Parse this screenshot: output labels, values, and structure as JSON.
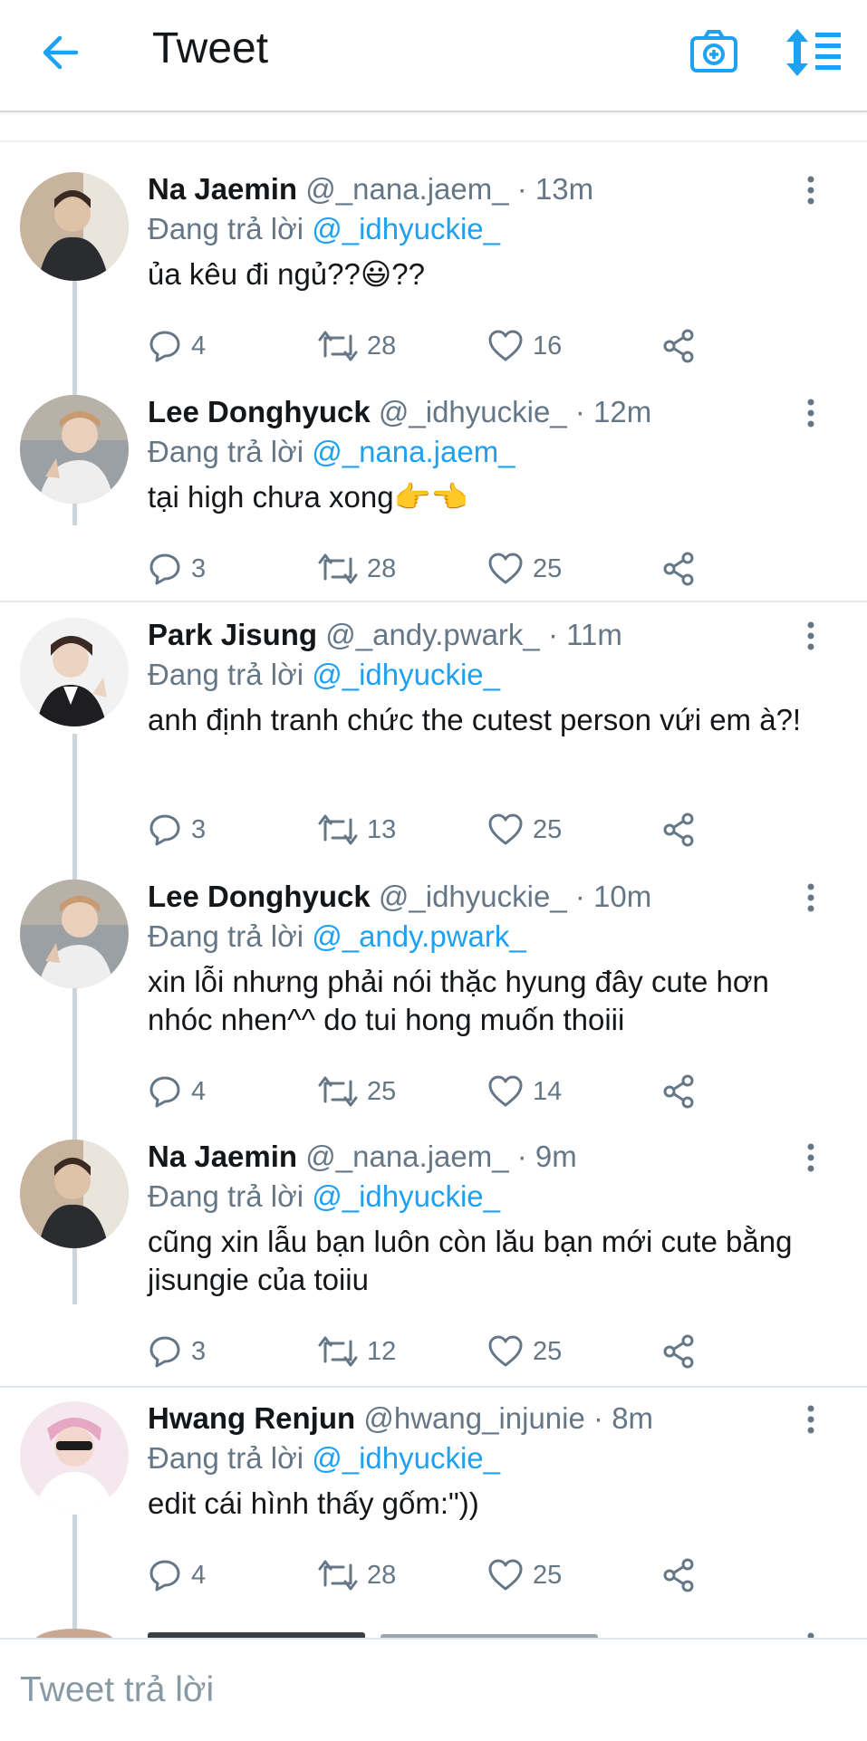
{
  "header": {
    "title": "Tweet",
    "back_icon": "arrow-left-icon",
    "camera_icon": "camera-plus-icon",
    "sort_icon": "sort-list-icon"
  },
  "colors": {
    "accent": "#1da1f2",
    "text": "#14171a",
    "muted": "#657786",
    "thread": "#ced5da"
  },
  "reply_prefix": "Đang trả lời",
  "tweets": [
    {
      "name": "Na Jaemin",
      "handle": "@_nana.jaem_",
      "time": "· 13m",
      "reply_to": "@_idhyuckie_",
      "text": "ủa kêu đi ngủ??😃??",
      "replies": "4",
      "retweets": "28",
      "likes": "16"
    },
    {
      "name": "Lee Donghyuck",
      "handle": "@_idhyuckie_",
      "time": "· 12m",
      "reply_to": "@_nana.jaem_",
      "text": "tại high chưa xong👉👈",
      "replies": "3",
      "retweets": "28",
      "likes": "25"
    },
    {
      "name": "Park Jisung",
      "handle": "@_andy.pwark_",
      "time": "· 11m",
      "reply_to": "@_idhyuckie_",
      "text": "anh định tranh chức the cutest person vứi em à?!",
      "replies": "3",
      "retweets": "13",
      "likes": "25"
    },
    {
      "name": "Lee Donghyuck",
      "handle": "@_idhyuckie_",
      "time": "· 10m",
      "reply_to": "@_andy.pwark_",
      "text": "xin lỗi nhưng phải nói thặc hyung đây cute hơn nhóc nhen^^ do tui hong muốn thoiii",
      "replies": "4",
      "retweets": "25",
      "likes": "14"
    },
    {
      "name": "Na Jaemin",
      "handle": "@_nana.jaem_",
      "time": "· 9m",
      "reply_to": "@_idhyuckie_",
      "text": "cũng xin lẫu bạn luôn còn lău bạn mới cute bằng jisungie của toiiu",
      "replies": "3",
      "retweets": "12",
      "likes": "25"
    },
    {
      "name": "Hwang Renjun",
      "handle": "@hwang_injunie",
      "time": "· 8m",
      "reply_to": "@_idhyuckie_",
      "text": "edit cái hình thấy gốm:\"))",
      "replies": "4",
      "retweets": "28",
      "likes": "25"
    }
  ],
  "composer": {
    "placeholder": "Tweet trả lời"
  }
}
